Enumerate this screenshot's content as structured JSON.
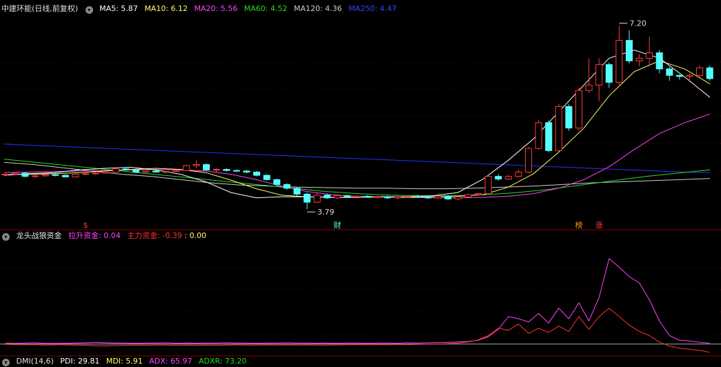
{
  "colors": {
    "background": "#000000",
    "up": "#ff3b3b",
    "down": "#54ffff",
    "grid": "#6b0000",
    "ma5": "#ffffff",
    "ma10": "#ffff66",
    "ma20": "#ff44ff",
    "ma60": "#22dd22",
    "ma120": "#cccccc",
    "ma250": "#2233ff",
    "lasheng": "#ff44ff",
    "zhuli": "#ff3333",
    "third": "#ffff66"
  },
  "top_legend": {
    "stock": "中建环能(日线,前复权)",
    "ma5": "MA5: 5.87",
    "ma10": "MA10: 6.12",
    "ma20": "MA20: 5.56",
    "ma60": "MA60: 4.52",
    "ma120": "MA120: 4.36",
    "ma250": "MA250: 4.47"
  },
  "bottom_legend": {
    "name": "龙头战狼资金",
    "lasheng": "拉升资金: 0.04",
    "zhuli": "主力资金: -0.39",
    "third": ": 0.00"
  },
  "dmi_legend": {
    "name": "DMI(14,6)",
    "pdi": "PDI: 29.81",
    "mdi": "MDI: 5.91",
    "adx": "ADX: 65.97",
    "adxr": "ADXR: 73.20"
  },
  "chart_data": [
    {
      "type": "candlestick",
      "title": "中建环能(日线,前复权)",
      "y_range": [
        3.6,
        7.4
      ],
      "annotations": {
        "high": "7.20",
        "low": "3.79"
      },
      "markers": [
        {
          "label": "$",
          "color": "#ff3b3b",
          "index": 8
        },
        {
          "label": "财",
          "color": "#54ffff",
          "index": 33
        },
        {
          "label": "榜",
          "color": "#ff9900",
          "index": 57
        },
        {
          "label": "涨",
          "color": "#ff3b3b",
          "index": 59
        }
      ],
      "ohlc": [
        [
          4.43,
          4.45,
          4.4,
          4.44
        ],
        [
          4.44,
          4.48,
          4.42,
          4.46
        ],
        [
          4.46,
          4.48,
          4.38,
          4.4
        ],
        [
          4.4,
          4.43,
          4.37,
          4.41
        ],
        [
          4.41,
          4.44,
          4.39,
          4.43
        ],
        [
          4.43,
          4.45,
          4.4,
          4.42
        ],
        [
          4.42,
          4.44,
          4.38,
          4.39
        ],
        [
          4.39,
          4.45,
          4.38,
          4.44
        ],
        [
          4.44,
          4.47,
          4.42,
          4.45
        ],
        [
          4.45,
          4.48,
          4.43,
          4.46
        ],
        [
          4.46,
          4.5,
          4.44,
          4.48
        ],
        [
          4.48,
          4.56,
          4.47,
          4.54
        ],
        [
          4.54,
          4.56,
          4.5,
          4.52
        ],
        [
          4.52,
          4.54,
          4.46,
          4.48
        ],
        [
          4.48,
          4.51,
          4.46,
          4.5
        ],
        [
          4.5,
          4.52,
          4.47,
          4.48
        ],
        [
          4.48,
          4.5,
          4.45,
          4.49
        ],
        [
          4.49,
          4.52,
          4.48,
          4.51
        ],
        [
          4.51,
          4.62,
          4.5,
          4.6
        ],
        [
          4.6,
          4.7,
          4.55,
          4.62
        ],
        [
          4.62,
          4.64,
          4.5,
          4.52
        ],
        [
          4.52,
          4.55,
          4.48,
          4.53
        ],
        [
          4.53,
          4.55,
          4.49,
          4.51
        ],
        [
          4.51,
          4.53,
          4.48,
          4.5
        ],
        [
          4.5,
          4.52,
          4.46,
          4.48
        ],
        [
          4.48,
          4.5,
          4.4,
          4.42
        ],
        [
          4.42,
          4.44,
          4.32,
          4.34
        ],
        [
          4.34,
          4.36,
          4.22,
          4.25
        ],
        [
          4.25,
          4.27,
          4.15,
          4.18
        ],
        [
          4.18,
          4.2,
          4.04,
          4.07
        ],
        [
          4.07,
          4.1,
          3.79,
          3.92
        ],
        [
          3.92,
          4.1,
          3.9,
          4.05
        ],
        [
          4.05,
          4.08,
          3.98,
          4.0
        ],
        [
          4.0,
          4.06,
          3.98,
          4.04
        ],
        [
          4.04,
          4.06,
          4.0,
          4.02
        ],
        [
          4.02,
          4.05,
          3.99,
          4.03
        ],
        [
          4.03,
          4.05,
          4.0,
          4.01
        ],
        [
          4.01,
          4.04,
          3.99,
          4.02
        ],
        [
          4.02,
          4.04,
          3.98,
          4.0
        ],
        [
          4.0,
          4.04,
          3.97,
          4.02
        ],
        [
          4.02,
          4.05,
          4.0,
          4.03
        ],
        [
          4.03,
          4.06,
          4.0,
          4.02
        ],
        [
          4.02,
          4.04,
          3.98,
          4.0
        ],
        [
          4.0,
          4.04,
          3.98,
          4.03
        ],
        [
          4.03,
          4.05,
          3.96,
          3.98
        ],
        [
          3.98,
          4.03,
          3.96,
          4.02
        ],
        [
          4.02,
          4.08,
          4.0,
          4.06
        ],
        [
          4.06,
          4.1,
          4.04,
          4.08
        ],
        [
          4.08,
          4.42,
          4.06,
          4.4
        ],
        [
          4.4,
          4.44,
          4.32,
          4.35
        ],
        [
          4.35,
          4.43,
          4.33,
          4.4
        ],
        [
          4.4,
          4.52,
          4.38,
          4.48
        ],
        [
          4.48,
          4.95,
          4.46,
          4.92
        ],
        [
          4.92,
          5.45,
          4.9,
          5.4
        ],
        [
          5.4,
          5.44,
          4.85,
          4.88
        ],
        [
          4.88,
          5.75,
          4.85,
          5.7
        ],
        [
          5.7,
          5.74,
          5.25,
          5.3
        ],
        [
          5.3,
          6.05,
          5.25,
          6.0
        ],
        [
          6.0,
          6.6,
          5.95,
          6.1
        ],
        [
          6.1,
          6.6,
          5.8,
          6.48
        ],
        [
          6.48,
          6.52,
          6.05,
          6.15
        ],
        [
          6.15,
          7.2,
          6.1,
          6.93
        ],
        [
          6.93,
          7.12,
          6.5,
          6.55
        ],
        [
          6.55,
          6.68,
          6.45,
          6.6
        ],
        [
          6.6,
          7.0,
          6.45,
          6.7
        ],
        [
          6.7,
          6.75,
          6.32,
          6.4
        ],
        [
          6.4,
          6.44,
          6.18,
          6.28
        ],
        [
          6.28,
          6.3,
          6.2,
          6.26
        ],
        [
          6.26,
          6.32,
          6.15,
          6.28
        ],
        [
          6.28,
          6.46,
          6.24,
          6.42
        ],
        [
          6.42,
          6.46,
          6.18,
          6.22
        ]
      ],
      "series": [
        {
          "name": "MA250",
          "color": "#2233ff",
          "values": [
            5.0,
            4.98,
            4.96,
            4.94,
            4.92,
            4.9,
            4.88,
            4.86,
            4.84,
            4.82,
            4.8,
            4.78,
            4.76,
            4.74,
            4.72,
            4.7,
            4.68,
            4.66,
            4.64,
            4.62,
            4.6,
            4.58,
            4.56,
            4.54,
            4.52,
            4.5,
            4.48,
            4.47
          ]
        },
        {
          "name": "MA120",
          "color": "#cccccc",
          "values": [
            4.66,
            4.62,
            4.56,
            4.5,
            4.44,
            4.4,
            4.34,
            4.28,
            4.24,
            4.22,
            4.2,
            4.19,
            4.18,
            4.18,
            4.17,
            4.17,
            4.18,
            4.2,
            4.22,
            4.25,
            4.28,
            4.3,
            4.32,
            4.34,
            4.36
          ]
        },
        {
          "name": "MA60",
          "color": "#22dd22",
          "values": [
            4.72,
            4.66,
            4.6,
            4.54,
            4.48,
            4.42,
            4.36,
            4.3,
            4.24,
            4.18,
            4.12,
            4.08,
            4.05,
            4.04,
            4.04,
            4.06,
            4.1,
            4.16,
            4.24,
            4.32,
            4.4,
            4.46,
            4.52
          ]
        },
        {
          "name": "MA20",
          "color": "#ff44ff",
          "values": [
            4.47,
            4.48,
            4.49,
            4.5,
            4.51,
            4.52,
            4.53,
            4.52,
            4.5,
            4.44,
            4.34,
            4.22,
            4.12,
            4.06,
            4.03,
            4.02,
            4.01,
            4.0,
            4.0,
            4.01,
            4.03,
            4.08,
            4.18,
            4.34,
            4.58,
            4.9,
            5.2,
            5.4,
            5.56
          ]
        },
        {
          "name": "MA10",
          "color": "#ffff66",
          "values": [
            4.43,
            4.44,
            4.45,
            4.47,
            4.5,
            4.53,
            4.55,
            4.53,
            4.47,
            4.33,
            4.17,
            4.05,
            4.02,
            4.01,
            4.01,
            4.02,
            4.01,
            4.02,
            4.03,
            4.06,
            4.2,
            4.45,
            4.85,
            5.3,
            5.9,
            6.35,
            6.55,
            6.4,
            6.12
          ]
        },
        {
          "name": "MA5",
          "color": "#ffffff",
          "values": [
            4.42,
            4.45,
            4.47,
            4.52,
            4.55,
            4.57,
            4.52,
            4.44,
            4.3,
            4.1,
            4.0,
            4.02,
            4.02,
            4.01,
            4.01,
            4.02,
            4.02,
            4.04,
            4.1,
            4.35,
            4.7,
            5.1,
            5.6,
            6.1,
            6.6,
            6.75,
            6.6,
            6.25,
            5.87
          ]
        }
      ]
    },
    {
      "type": "line",
      "title": "龙头战狼资金",
      "y_range": [
        -0.5,
        4.8
      ],
      "series": [
        {
          "name": "拉升资金",
          "color": "#ff44ff",
          "values": [
            0.05,
            0.03,
            0.05,
            0.06,
            0.03,
            0.03,
            0.04,
            0.05,
            0.06,
            0.08,
            0.06,
            0.05,
            0.05,
            0.04,
            0.05,
            0.05,
            0.06,
            0.04,
            0.05,
            0.04,
            0.05,
            0.05,
            0.06,
            0.05,
            0.05,
            0.04,
            0.05,
            0.05,
            0.06,
            0.05,
            0.05,
            0.04,
            0.05,
            0.04,
            0.05,
            0.05,
            0.04,
            0.05,
            0.05,
            0.04,
            0.06,
            0.05,
            0.06,
            0.07,
            0.08,
            0.1,
            0.12,
            0.18,
            0.35,
            0.7,
            1.3,
            1.2,
            1.05,
            1.45,
            1.0,
            1.7,
            1.2,
            1.95,
            1.1,
            2.2,
            4.05,
            3.65,
            3.2,
            2.9,
            2.1,
            1.1,
            0.4,
            0.18,
            0.15,
            0.08,
            0.04
          ]
        },
        {
          "name": "主力资金",
          "color": "#ff3333",
          "values": [
            -0.02,
            -0.03,
            -0.04,
            -0.03,
            -0.05,
            -0.04,
            -0.04,
            -0.05,
            -0.06,
            -0.08,
            -0.09,
            -0.07,
            -0.06,
            -0.05,
            -0.06,
            -0.05,
            -0.05,
            -0.06,
            -0.05,
            -0.06,
            -0.05,
            -0.06,
            -0.05,
            -0.04,
            -0.05,
            -0.05,
            -0.04,
            -0.05,
            -0.04,
            -0.05,
            -0.04,
            -0.05,
            -0.05,
            -0.04,
            -0.04,
            -0.03,
            -0.04,
            -0.03,
            -0.04,
            -0.03,
            -0.03,
            -0.02,
            -0.01,
            0.0,
            0.02,
            0.05,
            0.1,
            0.2,
            0.4,
            0.75,
            0.65,
            0.95,
            0.5,
            0.75,
            0.55,
            0.85,
            0.6,
            1.3,
            0.7,
            1.3,
            1.7,
            1.3,
            0.9,
            0.6,
            0.4,
            0.1,
            -0.1,
            -0.2,
            -0.25,
            -0.3,
            -0.39
          ]
        }
      ]
    }
  ]
}
